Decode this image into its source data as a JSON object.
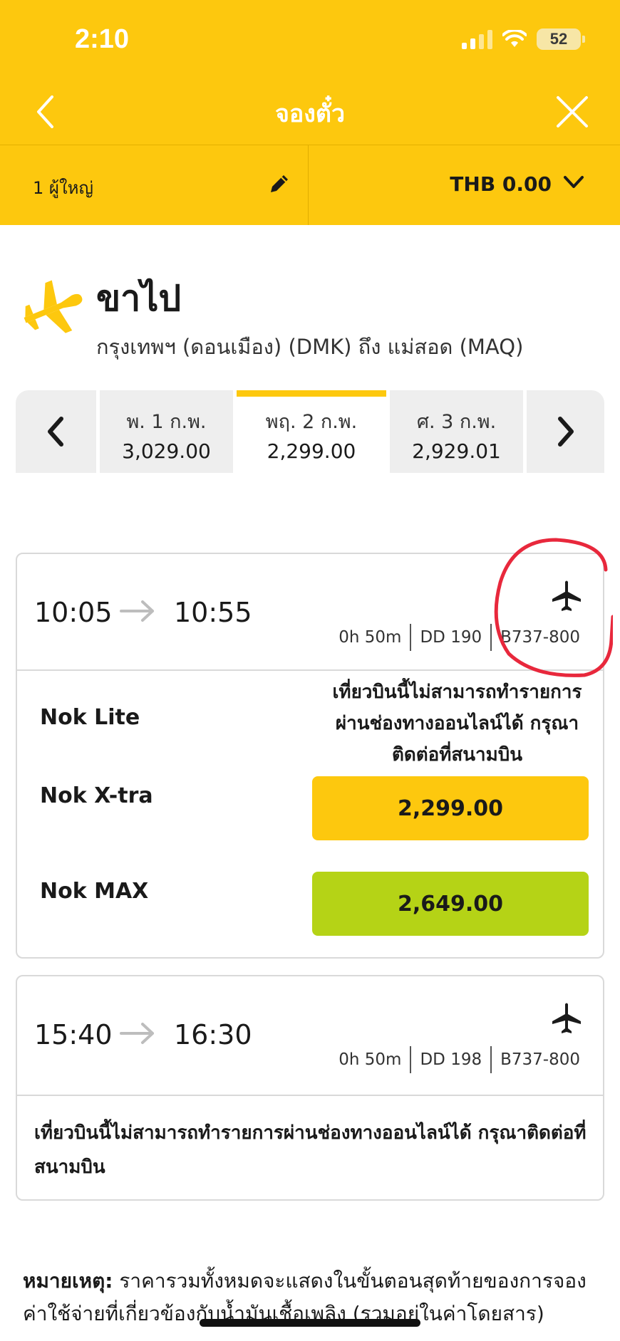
{
  "status_bar": {
    "time": "2:10",
    "battery": "52"
  },
  "nav": {
    "title": "จองตั๋ว",
    "back_icon": "chevron-left-icon",
    "close_icon": "close-icon"
  },
  "subheader": {
    "passengers": "1 ผู้ใหญ่",
    "currency": "THB 0.00"
  },
  "route": {
    "direction": "ขาไป",
    "description": "กรุงเทพฯ (ดอนเมือง) (DMK) ถึง แม่สอด (MAQ)"
  },
  "dates": [
    {
      "day": "พ. 1 ก.พ.",
      "price": "3,029.00",
      "selected": false
    },
    {
      "day": "พฤ. 2 ก.พ.",
      "price": "2,299.00",
      "selected": true
    },
    {
      "day": "ศ. 3 ก.พ.",
      "price": "2,929.01",
      "selected": false
    }
  ],
  "flights": [
    {
      "depart": "10:05",
      "arrive": "10:55",
      "duration": "0h 50m",
      "flight_no": "DD 190",
      "aircraft": "B737-800",
      "fares": [
        {
          "name": "Nok Lite",
          "message": "เที่ยวบินนี้ไม่สามารถทำรายการผ่านช่องทางออนไลน์ได้ กรุณาติดต่อที่สนามบิน"
        },
        {
          "name": "Nok X-tra",
          "price": "2,299.00"
        },
        {
          "name": "Nok MAX",
          "price": "2,649.00"
        }
      ]
    },
    {
      "depart": "15:40",
      "arrive": "16:30",
      "duration": "0h 50m",
      "flight_no": "DD 198",
      "aircraft": "B737-800",
      "message": "เที่ยวบินนี้ไม่สามารถทำรายการผ่านช่องทางออนไลน์ได้ กรุณาติดต่อที่สนามบิน"
    }
  ],
  "note": {
    "label": "หมายเหตุ:",
    "text": " ราคารวมทั้งหมดจะแสดงในขั้นตอนสุดท้ายของการจอง ค่าใช้จ่ายที่เกี่ยวข้องกับน้ำมันเชื้อเพลิง (รวมอยู่ในค่าโดยสาร)"
  },
  "colors": {
    "brand_yellow": "#fdc80e",
    "max_green": "#b5d316",
    "annotation_red": "#e8283c"
  }
}
